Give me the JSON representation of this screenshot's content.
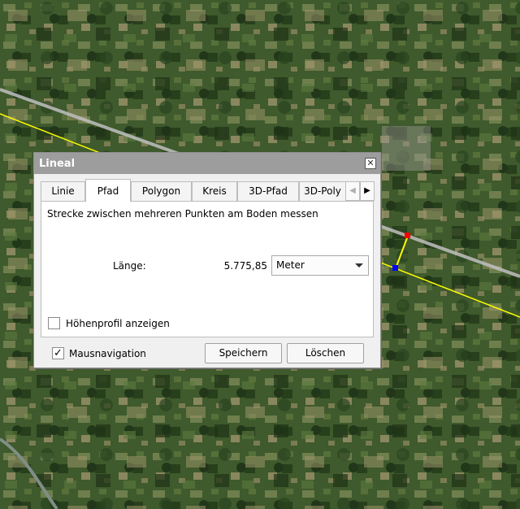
{
  "dialog": {
    "title": "Lineal",
    "close_glyph": "✕",
    "tabs": [
      {
        "label": "Linie"
      },
      {
        "label": "Pfad"
      },
      {
        "label": "Polygon"
      },
      {
        "label": "Kreis"
      },
      {
        "label": "3D-Pfad"
      },
      {
        "label": "3D-Poly"
      }
    ],
    "active_tab": "Pfad",
    "tab_scroll_left": "◀",
    "tab_scroll_right": "▶",
    "description": "Strecke zwischen mehreren Punkten am Boden messen",
    "length_label": "Länge:",
    "length_value": "5.775,85",
    "unit": "Meter",
    "elevation_profile": {
      "label": "Höhenprofil anzeigen",
      "checked": false
    },
    "mouse_navigation": {
      "label": "Mausnavigation",
      "checked": true,
      "mark": "✓"
    },
    "buttons": {
      "save": "Speichern",
      "delete": "Löschen"
    }
  },
  "colors": {
    "measure_line": "#ffff00",
    "start_marker": "#ff0000",
    "end_marker": "#0000ff",
    "road": "#c0c0c0"
  }
}
